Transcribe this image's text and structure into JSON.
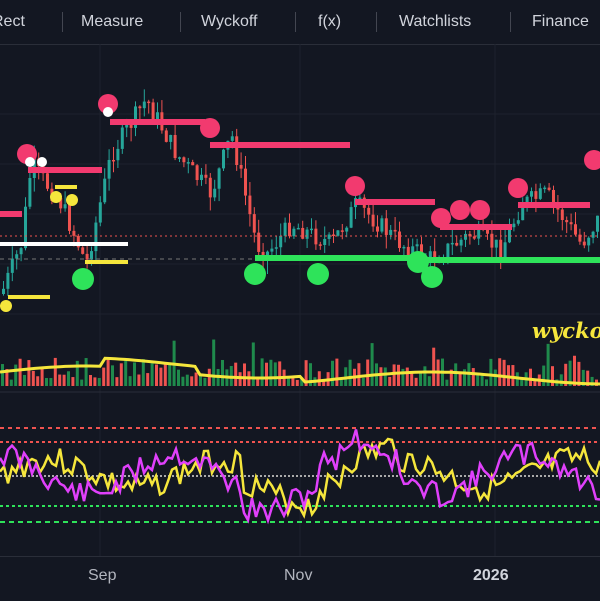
{
  "toolbar": {
    "items": [
      "Rect",
      "Measure",
      "Wyckoff",
      "f(x)",
      "Watchlists",
      "Finance"
    ]
  },
  "time_axis": {
    "labels": [
      "Sep",
      "Nov",
      "2026"
    ]
  },
  "overlay": {
    "watermark": "wyckoff"
  },
  "colors": {
    "background": "#131722",
    "up": "#26a69a",
    "down": "#ef5350",
    "resistance": "#f23a6f",
    "support": "#2ee35a",
    "marker_yellow": "#f5e63c",
    "oscillator_a": "#e040fb",
    "oscillator_b": "#f5e63c",
    "volume_ma": "#f5e63c"
  }
}
